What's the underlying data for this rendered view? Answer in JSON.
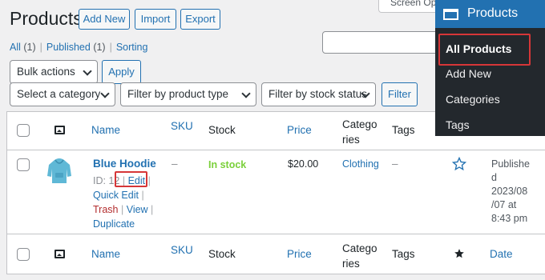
{
  "header": {
    "title": "Products",
    "add_new": "Add New",
    "import": "Import",
    "export": "Export",
    "screen_options": "Screen Options"
  },
  "views": {
    "all": "All",
    "all_count": "(1)",
    "published": "Published",
    "published_count": "(1)",
    "sorting": "Sorting"
  },
  "bulk": {
    "selected": "Bulk actions",
    "apply": "Apply"
  },
  "filters": {
    "category": "Select a category",
    "product_type": "Filter by product type",
    "stock_status": "Filter by stock status",
    "filter_button": "Filter"
  },
  "table": {
    "columns": {
      "name": "Name",
      "sku": "SKU",
      "stock": "Stock",
      "price": "Price",
      "categories_1": "Catego",
      "categories_2": "ries",
      "tags": "Tags",
      "date": "Date"
    },
    "row": {
      "name": "Blue Hoodie",
      "id": "ID: 12",
      "edit": "Edit",
      "quick_edit": "Quick Edit",
      "trash": "Trash",
      "view": "View",
      "duplicate": "Duplicate",
      "sku": "–",
      "stock": "In stock",
      "price": "$20.00",
      "category": "Clothing",
      "tags": "–",
      "date_lines": [
        "Publishe",
        "d",
        "2023/08",
        "/07 at",
        "8:43 pm"
      ]
    }
  },
  "admin_menu": {
    "title": "Products",
    "items": [
      "All Products",
      "Add New",
      "Categories",
      "Tags"
    ]
  },
  "colors": {
    "accent": "#2271b1",
    "highlight": "#d63638",
    "in_stock": "#7ad03a",
    "menu_bg": "#23282d"
  }
}
